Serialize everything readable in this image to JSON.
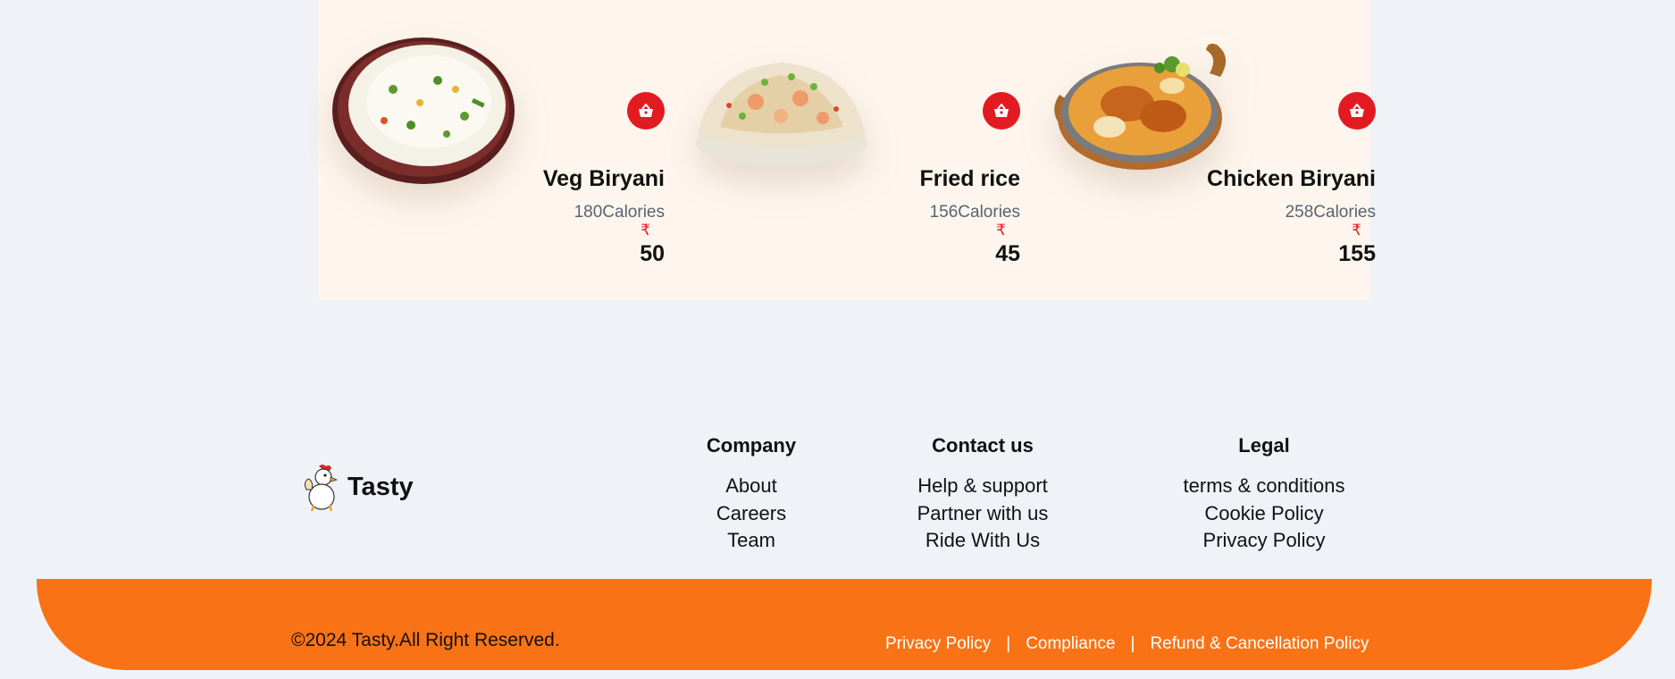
{
  "menu": {
    "items": [
      {
        "name": "Veg Biryani",
        "calories": "180Calories",
        "currency": "₹",
        "price": "50"
      },
      {
        "name": "Fried rice",
        "calories": "156Calories",
        "currency": "₹",
        "price": "45"
      },
      {
        "name": "Chicken Biryani",
        "calories": "258Calories",
        "currency": "₹",
        "price": "155"
      }
    ]
  },
  "footer": {
    "brand": "Tasty",
    "company": {
      "heading": "Company",
      "links": [
        "About",
        "Careers",
        "Team"
      ]
    },
    "contact": {
      "heading": "Contact us",
      "links": [
        "Help & support",
        "Partner with us",
        "Ride With Us"
      ]
    },
    "legal": {
      "heading": "Legal",
      "links": [
        "terms & conditions",
        "Cookie Policy",
        "Privacy Policy"
      ]
    },
    "copyright": "©2024 Tasty.All Right Reserved.",
    "bottom_links": [
      "Privacy Policy",
      "Compliance",
      "Refund & Cancellation Policy"
    ],
    "separator": "|"
  },
  "colors": {
    "accent": "#f97316",
    "cart": "#e21b23",
    "panel": "#fef6ee",
    "background": "#eff3f8"
  }
}
